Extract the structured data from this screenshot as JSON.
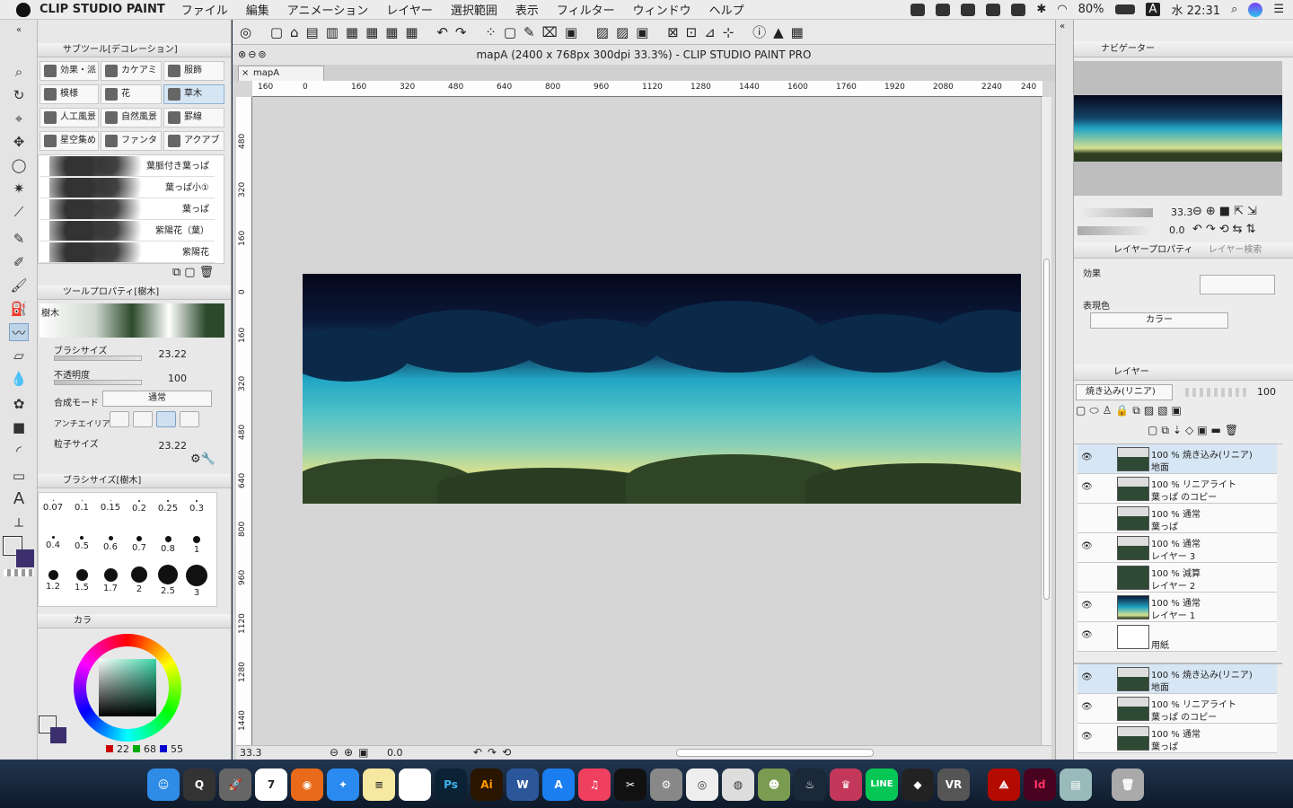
{
  "menubar": {
    "app_name": "CLIP STUDIO PAINT",
    "items": [
      "ファイル",
      "編集",
      "アニメーション",
      "レイヤー",
      "選択範囲",
      "表示",
      "フィルター",
      "ウィンドウ",
      "ヘルプ"
    ],
    "battery": "80%",
    "clock": "水 22:31",
    "input_mode": "A"
  },
  "window": {
    "title": "mapA (2400 x 768px 300dpi 33.3%)  - CLIP STUDIO PAINT PRO",
    "doc_tab": "mapA"
  },
  "subtool": {
    "header": "サブツール[デコレーション]",
    "groups": [
      "効果・派",
      "カケアミ",
      "服飾",
      "模様",
      "花",
      "草木",
      "人工風景",
      "自然風景",
      "罫線",
      "星空集め",
      "ファンタ",
      "アクアブ"
    ],
    "selected_group": "草木",
    "brushes": [
      "葉脈付き葉っぱ",
      "葉っぱ小①",
      "葉っぱ",
      "紫陽花（葉）",
      "紫陽花"
    ]
  },
  "tool_property": {
    "header": "ツールプロパティ[樹木]",
    "preview_label": "樹木",
    "brush_size_label": "ブラシサイズ",
    "brush_size": "23.22",
    "opacity_label": "不透明度",
    "opacity": "100",
    "blend_label": "合成モード",
    "blend_value": "通常",
    "antialias_label": "アンチエイリアス",
    "particle_label": "粒子サイズ",
    "particle_size": "23.22"
  },
  "brush_size_palette": {
    "header": "ブラシサイズ[樹木]",
    "sizes": [
      "0.07",
      "0.1",
      "0.15",
      "0.2",
      "0.25",
      "0.3",
      "0.4",
      "0.5",
      "0.6",
      "0.7",
      "0.8",
      "1",
      "1.2",
      "1.5",
      "1.7",
      "2",
      "2.5",
      "3"
    ]
  },
  "color": {
    "tab": "カラ",
    "main_color": "#1f4a3c",
    "sub_color": "#3c2f6e",
    "r": "22",
    "g": "68",
    "b": "55"
  },
  "canvas": {
    "ruler_top": [
      "160",
      "0",
      "160",
      "320",
      "480",
      "640",
      "800",
      "960",
      "1120",
      "1280",
      "1440",
      "1600",
      "1760",
      "1920",
      "2080",
      "2240",
      "240"
    ],
    "ruler_left": [
      "480",
      "320",
      "160",
      "0",
      "160",
      "320",
      "480",
      "640",
      "800",
      "960",
      "1120",
      "1280",
      "1440"
    ],
    "zoom": "33.3",
    "angle": "0.0"
  },
  "navigator": {
    "tab": "ナビゲーター",
    "zoom": "33.3",
    "rotation": "0.0"
  },
  "layer_property": {
    "tab": "レイヤープロパティ",
    "tab2": "レイヤー検索",
    "effect_label": "効果",
    "expression_label": "表現色",
    "expression_value": "カラー"
  },
  "layers": {
    "tab": "レイヤー",
    "blend": "焼き込み(リニア)",
    "opacity": "100",
    "items": [
      {
        "mode": "100 % 焼き込み(リニア)",
        "name": "地面",
        "visible": true,
        "selected": true
      },
      {
        "mode": "100 % リニアライト",
        "name": "葉っぱ のコピー",
        "visible": true,
        "selected": false
      },
      {
        "mode": "100 % 通常",
        "name": "葉っぱ",
        "visible": false,
        "selected": false
      },
      {
        "mode": "100 % 通常",
        "name": "レイヤー 3",
        "visible": true,
        "selected": false
      },
      {
        "mode": "100 % 減算",
        "name": "レイヤー 2",
        "visible": false,
        "selected": false
      },
      {
        "mode": "100 % 通常",
        "name": "レイヤー 1",
        "visible": true,
        "selected": false
      }
    ],
    "paper": "用紙",
    "items2": [
      {
        "mode": "100 % 焼き込み(リニア)",
        "name": "地面",
        "visible": true,
        "selected": true
      },
      {
        "mode": "100 % リニアライト",
        "name": "葉っぱ のコピー",
        "visible": true,
        "selected": false
      },
      {
        "mode": "100 % 通常",
        "name": "葉っぱ",
        "visible": true,
        "selected": false
      }
    ]
  },
  "dock": [
    "Finder",
    "QuickTime",
    "Launchpad",
    "Calendar",
    "Firefox",
    "Safari",
    "Notes",
    "Photos",
    "Ps",
    "Ai",
    "W",
    "App Store",
    "Music",
    "CapCut",
    "Prefs",
    "CSP",
    "CSP2",
    "Game",
    "Steam",
    "Game2",
    "LINE",
    "Unity",
    "VR",
    "Acrobat",
    "Id",
    "Preview",
    "Trash"
  ]
}
